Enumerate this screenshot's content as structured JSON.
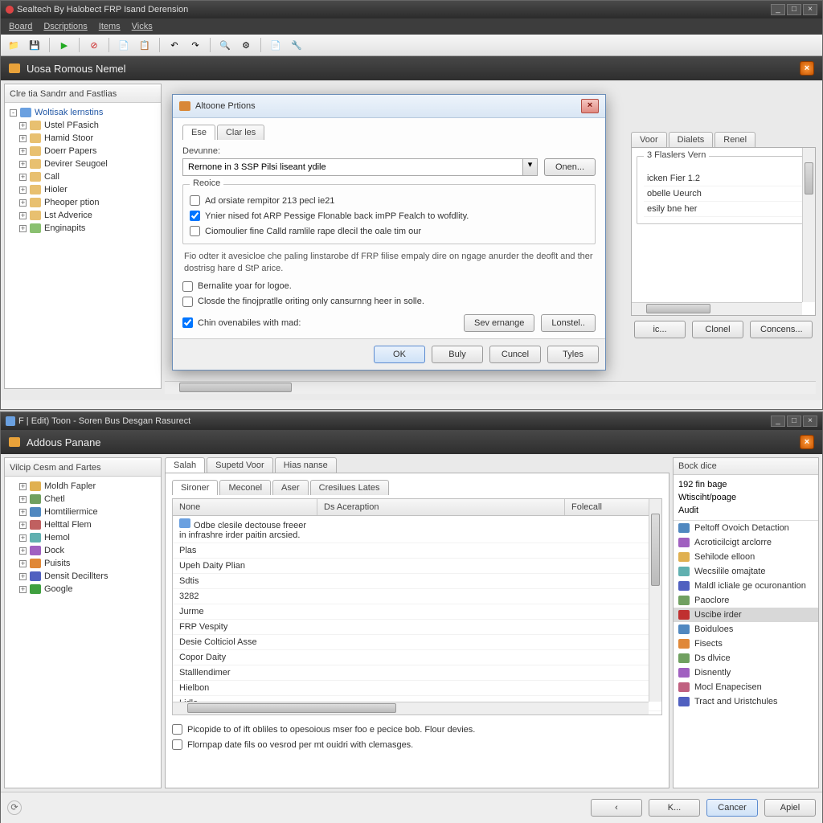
{
  "top_window": {
    "title": "Sealtech By Halobect FRP Isand Derension",
    "menu": [
      "Board",
      "Dscriptions",
      "Items",
      "Vicks"
    ],
    "panel_title": "Uosa Romous Nemel",
    "sidebar_title": "Clre tia Sandrr and Fastlias",
    "tree_root": "Woltisak lernstins",
    "tree_items": [
      "Ustel PFasich",
      "Hamid Stoor",
      "Doerr Papers",
      "Devirer Seugoel",
      "Call",
      "Hioler",
      "Pheoper ption",
      "Lst Adverice",
      "Enginapits"
    ],
    "tabs": [
      "Voor",
      "Dialets",
      "Renel"
    ],
    "group_title": "3 Flaslers Vern",
    "group_items": [
      "icken Fier 1.2",
      "obelle Ueurch",
      "esily bne her"
    ],
    "buttons": [
      "ic...",
      "Clonel",
      "Concens..."
    ]
  },
  "modal": {
    "title": "Altoone Prtions",
    "tabs": [
      "Ese",
      "Clar les"
    ],
    "field_label": "Devunne:",
    "combo_value": "Rernone in 3 SSP Pilsi liseant ydile",
    "open_btn": "Onen...",
    "group_label": "Reoice",
    "check1": "Ad orsiate rempitor 213 pecl ie21",
    "check2": "Ynier nised fot ARP Pessige Flonable back imPP Fealch to wofdlity.",
    "check3": "Ciomoulier fine Calld ramlile rape dlecil the oale tim our",
    "desc": "Fio odter it avesicloe che paling linstarobe df FRP filise empaly dire on ngage anurder the deoflt and ther dostrisg hare d StP arice.",
    "check4": "Bernalite yoar for logoe.",
    "check5": "Closde the finojpratlle oriting only cansurnng heer in solle.",
    "check6": "Chin ovenabiles with mad:",
    "save_btn": "Sev ernange",
    "load_btn": "Lonstel..",
    "ok": "OK",
    "buly": "Buly",
    "cancel": "Cuncel",
    "tyles": "Tyles"
  },
  "bottom_window": {
    "title": "F | Edit) Toon - Soren Bus Desgan Rasurect",
    "panel_title": "Addous Panane",
    "sidebar_title": "Vilcip Cesm and Fartes",
    "tree_items": [
      "Moldh Fapler",
      "Chetl",
      "Homtiliermice",
      "Helttal Flem",
      "Hemol",
      "Dock",
      "Puisits",
      "Densit Decillters",
      "Google"
    ],
    "main_tabs": [
      "Salah",
      "Supetd Voor",
      "Hias nanse"
    ],
    "sub_tabs": [
      "Sironer",
      "Meconel",
      "Aser",
      "Cresilues Lates"
    ],
    "table_headers": [
      "None",
      "Ds Aceraption",
      "Folecall"
    ],
    "table_rows": [
      {
        "n": "Odbe clesile dectouse freeer in infrashre irder paitin arcsied.",
        "d": "",
        "f": ""
      },
      {
        "n": "Plas",
        "d": "",
        "f": ""
      },
      {
        "n": "Upeh Daity Plian",
        "d": "",
        "f": ""
      },
      {
        "n": "Sdtis",
        "d": "",
        "f": ""
      },
      {
        "n": "3282",
        "d": "",
        "f": ""
      },
      {
        "n": "Jurme",
        "d": "",
        "f": ""
      },
      {
        "n": "FRP Vespity",
        "d": "",
        "f": ""
      },
      {
        "n": "Desie Colticiol Asse",
        "d": "",
        "f": ""
      },
      {
        "n": "Copor Daity",
        "d": "",
        "f": ""
      },
      {
        "n": "Stalllendimer",
        "d": "",
        "f": ""
      },
      {
        "n": "Hielbon",
        "d": "",
        "f": ""
      },
      {
        "n": "Lidle",
        "d": "",
        "f": ""
      }
    ],
    "bottom_check1": "Picopide to of ift obliles to opesoious mser foo e pecice bob. Flour devies.",
    "bottom_check2": "Flornpap date fils oo vesrod per mt ouidri with clemasges.",
    "right_title": "Bock dice",
    "right_top": [
      "192 fin bage",
      "Wtisciht/poage",
      "Audit"
    ],
    "right_items": [
      "Peltoff Ovoich Detaction",
      "Acroticilcigt arclorre",
      "Sehilode elloon",
      "Wecsilile omajtate",
      "Maldl icliale ge ocuronantion",
      "Paoclore",
      "Uscibe irder",
      "Boiduloes",
      "Fisects",
      "Ds dlvice",
      "Disnently",
      "Mocl Enapecisen",
      "Tract and Uristchules"
    ],
    "right_selected": 6,
    "footer_k": "K...",
    "footer_cancel": "Cancer",
    "footer_apply": "Apiel"
  }
}
